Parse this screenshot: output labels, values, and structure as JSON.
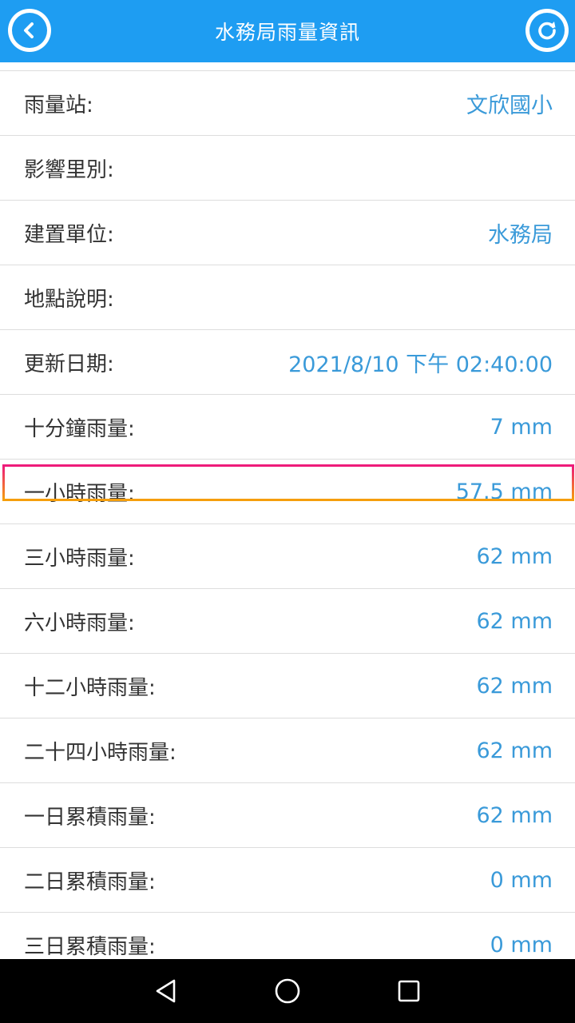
{
  "header": {
    "title": "水務局雨量資訊",
    "back_icon": "chevron-left-icon",
    "refresh_icon": "refresh-icon",
    "color": "#1e9df2"
  },
  "rows": [
    {
      "label": "雨量站:",
      "value": "文欣國小"
    },
    {
      "label": "影響里別:",
      "value": ""
    },
    {
      "label": "建置單位:",
      "value": "水務局"
    },
    {
      "label": "地點說明:",
      "value": ""
    },
    {
      "label": "更新日期:",
      "value": "2021/8/10 下午 02:40:00"
    },
    {
      "label": "十分鐘雨量:",
      "value": "7 mm"
    },
    {
      "label": "一小時雨量:",
      "value": "57.5 mm"
    },
    {
      "label": "三小時雨量:",
      "value": "62 mm"
    },
    {
      "label": "六小時雨量:",
      "value": "62 mm"
    },
    {
      "label": "十二小時雨量:",
      "value": "62 mm"
    },
    {
      "label": "二十四小時雨量:",
      "value": "62 mm"
    },
    {
      "label": "一日累積雨量:",
      "value": "62 mm"
    },
    {
      "label": "二日累積雨量:",
      "value": "0 mm"
    },
    {
      "label": "三日累積雨量:",
      "value": "0 mm"
    }
  ],
  "colors": {
    "value_text": "#3a9ad9",
    "label_text": "#333333",
    "highlight_top": "#ee1a7b",
    "highlight_bottom": "#f59f0c"
  },
  "navbar": {
    "back_icon": "triangle-back-icon",
    "home_icon": "circle-home-icon",
    "recents_icon": "square-recents-icon"
  }
}
